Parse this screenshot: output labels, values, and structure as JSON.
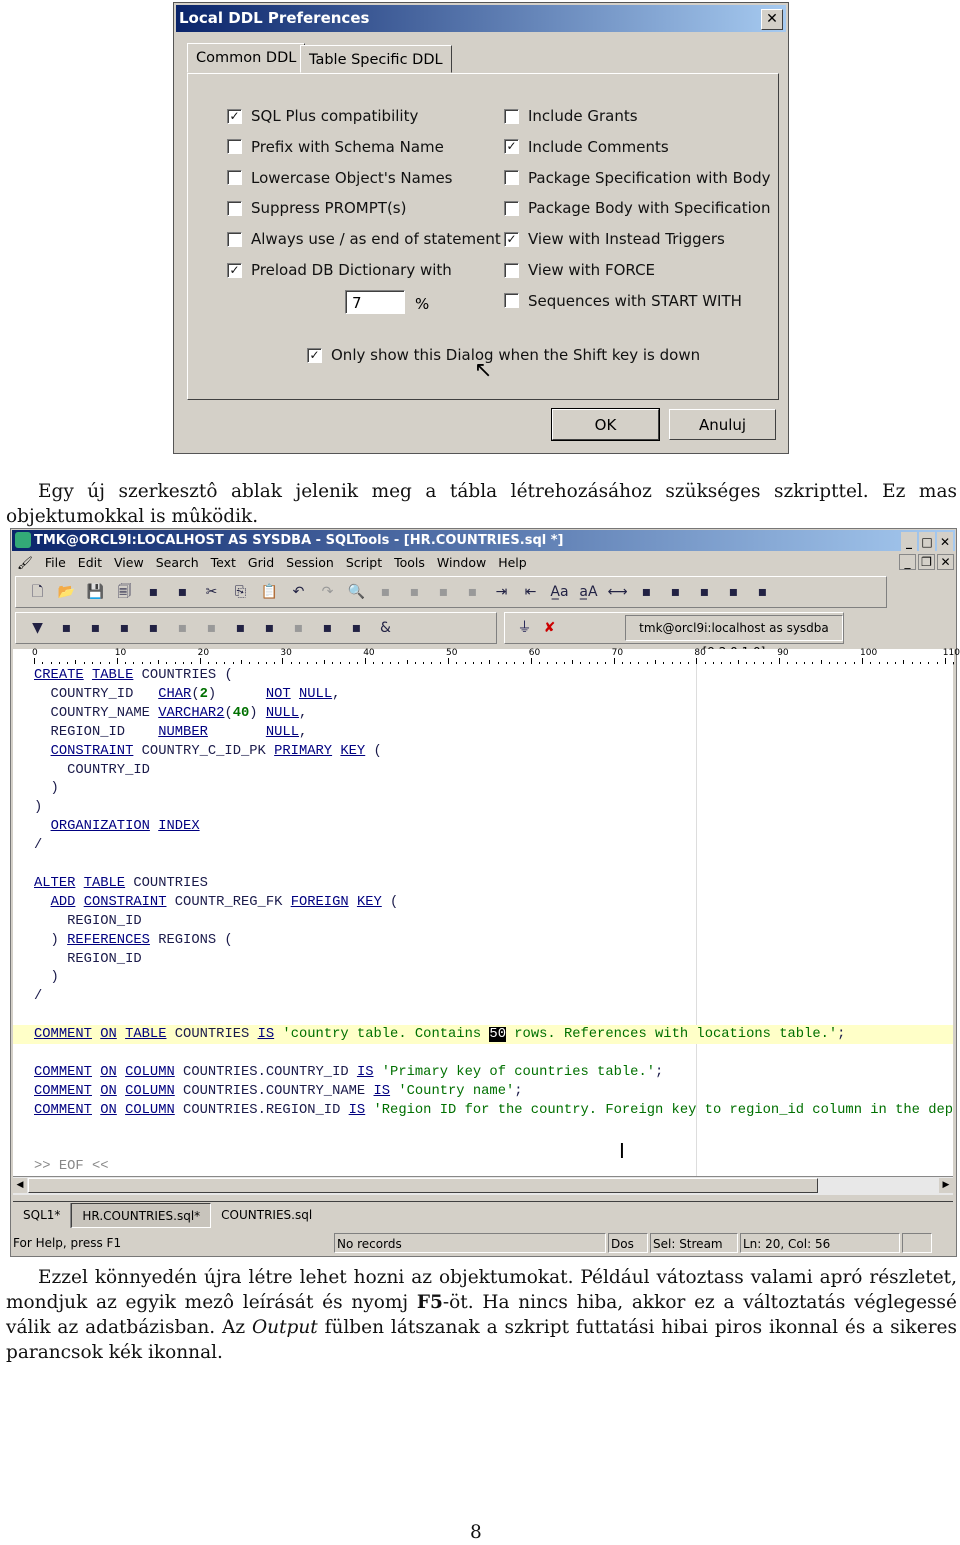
{
  "dialog": {
    "title": "Local DDL Preferences",
    "close": "✕",
    "tabs": [
      "Common DDL",
      "Table Specific DDL"
    ],
    "left": [
      {
        "label": "SQL Plus compatibility",
        "checked": true
      },
      {
        "label": "Prefix with Schema Name",
        "checked": false
      },
      {
        "label": "Lowercase Object's Names",
        "checked": false
      },
      {
        "label": "Suppress PROMPT(s)",
        "checked": false
      },
      {
        "label": "Always use / as end of statement",
        "checked": false
      },
      {
        "label": "Preload DB Dictionary with",
        "checked": true
      }
    ],
    "right": [
      {
        "label": "Include Grants",
        "checked": false
      },
      {
        "label": "Include Comments",
        "checked": true
      },
      {
        "label": "Package Specification with Body",
        "checked": false
      },
      {
        "label": "Package Body with Specification",
        "checked": false
      },
      {
        "label": "View with Instead Triggers",
        "checked": true
      },
      {
        "label": "View with FORCE",
        "checked": false
      },
      {
        "label": "Sequences with START WITH",
        "checked": false
      }
    ],
    "percent_value": "7",
    "percent_unit": "%",
    "shift_option": {
      "label": "Only show this Dialog when the Shift key is down",
      "checked": true
    },
    "ok": "OK",
    "cancel": "Anuluj"
  },
  "para1": "Egy új szerkesztô ablak jelenik meg a tábla létrehozásához szükséges szkripttel. Ez mas objektumokkal is mûködik.",
  "window": {
    "title": "TMK@ORCL9I:LOCALHOST AS SYSDBA - SQLTools - [HR.COUNTRIES.sql *]",
    "menu": [
      "File",
      "Edit",
      "View",
      "Search",
      "Text",
      "Grid",
      "Session",
      "Script",
      "Tools",
      "Window",
      "Help"
    ],
    "toolbar1": [
      "new-file",
      "open",
      "save",
      "save-all",
      "paste-special",
      "copy-special",
      "cut",
      "copy",
      "paste",
      "undo",
      "redo",
      "find",
      "find-next",
      "find-prev",
      "find-all",
      "find-object",
      "indent",
      "unindent",
      "uppercase",
      "lowercase",
      "match-bracket",
      "insert-file",
      "bookmark",
      "bookmark-next",
      "bookmark-prev",
      "bookmark-clear"
    ],
    "toolbar2": [
      "execute",
      "execute-current",
      "run-script",
      "run-step",
      "run-all",
      "disabled-1",
      "disabled-2",
      "describe",
      "sql-history",
      "find-objects",
      "output",
      "plan",
      "substitution",
      "connect",
      "disconnect"
    ],
    "connection": "tmk@orcl9i:localhost as sysdba [9.2.0.1.0]",
    "ruler": [
      "0",
      "10",
      "20",
      "30",
      "40",
      "50",
      "60",
      "70",
      "80",
      "90",
      "100",
      "110"
    ],
    "code": [
      [
        [
          "CREATE",
          "k"
        ],
        [
          " ",
          "p"
        ],
        [
          "TABLE",
          "k"
        ],
        [
          " COUNTRIES (",
          "p"
        ]
      ],
      [
        [
          "  COUNTRY_ID   ",
          "p"
        ],
        [
          "CHAR",
          "k"
        ],
        [
          "(",
          "p"
        ],
        [
          "2",
          "n"
        ],
        [
          ")      ",
          "p"
        ],
        [
          "NOT",
          "k"
        ],
        [
          " ",
          "p"
        ],
        [
          "NULL",
          "k"
        ],
        [
          ",",
          "p"
        ]
      ],
      [
        [
          "  COUNTRY_NAME ",
          "p"
        ],
        [
          "VARCHAR2",
          "k"
        ],
        [
          "(",
          "p"
        ],
        [
          "40",
          "n"
        ],
        [
          ") ",
          "p"
        ],
        [
          "NULL",
          "k"
        ],
        [
          ",",
          "p"
        ]
      ],
      [
        [
          "  REGION_ID    ",
          "p"
        ],
        [
          "NUMBER",
          "k"
        ],
        [
          "       ",
          "p"
        ],
        [
          "NULL",
          "k"
        ],
        [
          ",",
          "p"
        ]
      ],
      [
        [
          "  ",
          "p"
        ],
        [
          "CONSTRAINT",
          "k"
        ],
        [
          " COUNTRY_C_ID_PK ",
          "p"
        ],
        [
          "PRIMARY",
          "k"
        ],
        [
          " ",
          "p"
        ],
        [
          "KEY",
          "k"
        ],
        [
          " (",
          "p"
        ]
      ],
      [
        [
          "    COUNTRY_ID",
          "p"
        ]
      ],
      [
        [
          "  )",
          "p"
        ]
      ],
      [
        [
          ")",
          "p"
        ]
      ],
      [
        [
          "  ",
          "p"
        ],
        [
          "ORGANIZATION",
          "k"
        ],
        [
          " ",
          "p"
        ],
        [
          "INDEX",
          "k"
        ]
      ],
      [
        [
          "/",
          "p"
        ]
      ],
      [],
      [
        [
          "ALTER",
          "k"
        ],
        [
          " ",
          "p"
        ],
        [
          "TABLE",
          "k"
        ],
        [
          " COUNTRIES",
          "p"
        ]
      ],
      [
        [
          "  ",
          "p"
        ],
        [
          "ADD",
          "k"
        ],
        [
          " ",
          "p"
        ],
        [
          "CONSTRAINT",
          "k"
        ],
        [
          " COUNTR_REG_FK ",
          "p"
        ],
        [
          "FOREIGN",
          "k"
        ],
        [
          " ",
          "p"
        ],
        [
          "KEY",
          "k"
        ],
        [
          " (",
          "p"
        ]
      ],
      [
        [
          "    REGION_ID",
          "p"
        ]
      ],
      [
        [
          "  ) ",
          "p"
        ],
        [
          "REFERENCES",
          "k"
        ],
        [
          " REGIONS (",
          "p"
        ]
      ],
      [
        [
          "    REGION_ID",
          "p"
        ]
      ],
      [
        [
          "  )",
          "p"
        ]
      ],
      [
        [
          "/",
          "p"
        ]
      ],
      [],
      [
        [
          "COMMENT",
          "k"
        ],
        [
          " ",
          "p"
        ],
        [
          "ON",
          "k"
        ],
        [
          " ",
          "p"
        ],
        [
          "TABLE",
          "k"
        ],
        [
          " COUNTRIES ",
          "p"
        ],
        [
          "IS",
          "k"
        ],
        [
          " 'country table. Contains ",
          "s"
        ],
        [
          "50",
          "sel"
        ],
        [
          " rows. References with locations table.'",
          "s"
        ],
        [
          ";",
          "p"
        ]
      ],
      [],
      [
        [
          "COMMENT",
          "k"
        ],
        [
          " ",
          "p"
        ],
        [
          "ON",
          "k"
        ],
        [
          " ",
          "p"
        ],
        [
          "COLUMN",
          "k"
        ],
        [
          " COUNTRIES.COUNTRY_ID ",
          "p"
        ],
        [
          "IS",
          "k"
        ],
        [
          " 'Primary key of countries table.'",
          "s"
        ],
        [
          ";",
          "p"
        ]
      ],
      [
        [
          "COMMENT",
          "k"
        ],
        [
          " ",
          "p"
        ],
        [
          "ON",
          "k"
        ],
        [
          " ",
          "p"
        ],
        [
          "COLUMN",
          "k"
        ],
        [
          " COUNTRIES.COUNTRY_NAME ",
          "p"
        ],
        [
          "IS",
          "k"
        ],
        [
          " 'Country name'",
          "s"
        ],
        [
          ";",
          "p"
        ]
      ],
      [
        [
          "COMMENT",
          "k"
        ],
        [
          " ",
          "p"
        ],
        [
          "ON",
          "k"
        ],
        [
          " ",
          "p"
        ],
        [
          "COLUMN",
          "k"
        ],
        [
          " COUNTRIES.REGION_ID ",
          "p"
        ],
        [
          "IS",
          "k"
        ],
        [
          " 'Region ID for the country. Foreign key to region_id column in the dep",
          "s"
        ]
      ],
      [],
      [],
      [
        [
          ">> EOF <<",
          "e"
        ]
      ]
    ],
    "current_line": 19,
    "doc_tabs": [
      "SQL1*",
      "HR.COUNTRIES.sql*",
      "COUNTRIES.sql"
    ],
    "status": {
      "help": "For Help, press F1",
      "records": "No records",
      "format": "Dos",
      "sel": "Sel: Stream",
      "pos": "Ln: 20, Col: 56"
    }
  },
  "para2": [
    [
      "Ezzel könnyedén újra létre lehet hozni az objektumokat. Például vátoztass valami apró részletet, mondjuk az egyik mezô leírását és nyomj ",
      ""
    ],
    [
      "F5",
      "b"
    ],
    [
      "-öt. Ha nincs hiba, akkor ez a változtatás véglegessé válik az adatbázisban. Az ",
      ""
    ],
    [
      "Output",
      "i"
    ],
    [
      " fülben látszanak a szkript futtatási hibai piros ikonnal és a sikeres parancsok kék ikonnal.",
      ""
    ]
  ],
  "page_number": "8"
}
